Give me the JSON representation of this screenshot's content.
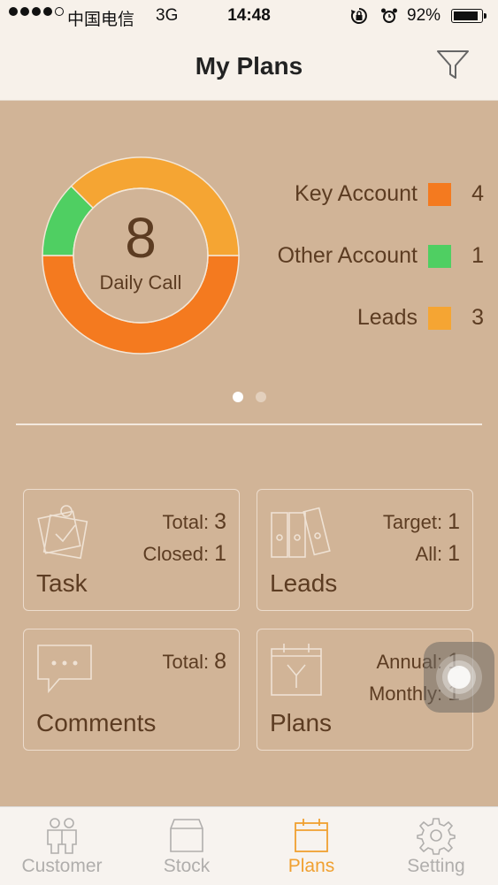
{
  "status_bar": {
    "carrier": "中国电信",
    "network": "3G",
    "time": "14:48",
    "battery_percent": "92%",
    "battery_level": 0.92,
    "signal_dots_filled": 4
  },
  "header": {
    "title": "My Plans",
    "filter_icon": "filter-funnel-icon"
  },
  "donut": {
    "value": "8",
    "label": "Daily Call",
    "segments": [
      {
        "name": "Key Account",
        "value": 4,
        "color": "#f47a1f"
      },
      {
        "name": "Other Account",
        "value": 1,
        "color": "#4fcf62"
      },
      {
        "name": "Leads",
        "value": 3,
        "color": "#f5a533"
      }
    ]
  },
  "legend": [
    {
      "label": "Key Account",
      "count": "4",
      "color": "#f47a1f"
    },
    {
      "label": "Other Account",
      "count": "1",
      "color": "#4fcf62"
    },
    {
      "label": "Leads",
      "count": "3",
      "color": "#f5a533"
    }
  ],
  "pager": {
    "current": 1,
    "total": 2
  },
  "cards": {
    "task": {
      "title": "Task",
      "total_label": "Total:",
      "total": "3",
      "closed_label": "Closed:",
      "closed": "1",
      "icon": "task-clipboard-icon"
    },
    "leads": {
      "title": "Leads",
      "target_label": "Target:",
      "target": "1",
      "all_label": "All:",
      "all": "1",
      "icon": "binders-icon"
    },
    "comments": {
      "title": "Comments",
      "total_label": "Total:",
      "total": "8",
      "icon": "speech-bubble-icon"
    },
    "plans": {
      "title": "Plans",
      "annual_label": "Annual:",
      "annual": "1",
      "monthly_label": "Monthly:",
      "monthly": "1",
      "icon": "calendar-year-icon"
    }
  },
  "tabs": [
    {
      "label": "Customer",
      "icon": "customer-people-icon",
      "active": false
    },
    {
      "label": "Stock",
      "icon": "stock-box-icon",
      "active": false
    },
    {
      "label": "Plans",
      "icon": "plans-calendar-icon",
      "active": true
    },
    {
      "label": "Setting",
      "icon": "gear-icon",
      "active": false
    }
  ],
  "colors": {
    "background": "#d1b497",
    "text": "#5c3c22",
    "accent": "#f0a030"
  }
}
